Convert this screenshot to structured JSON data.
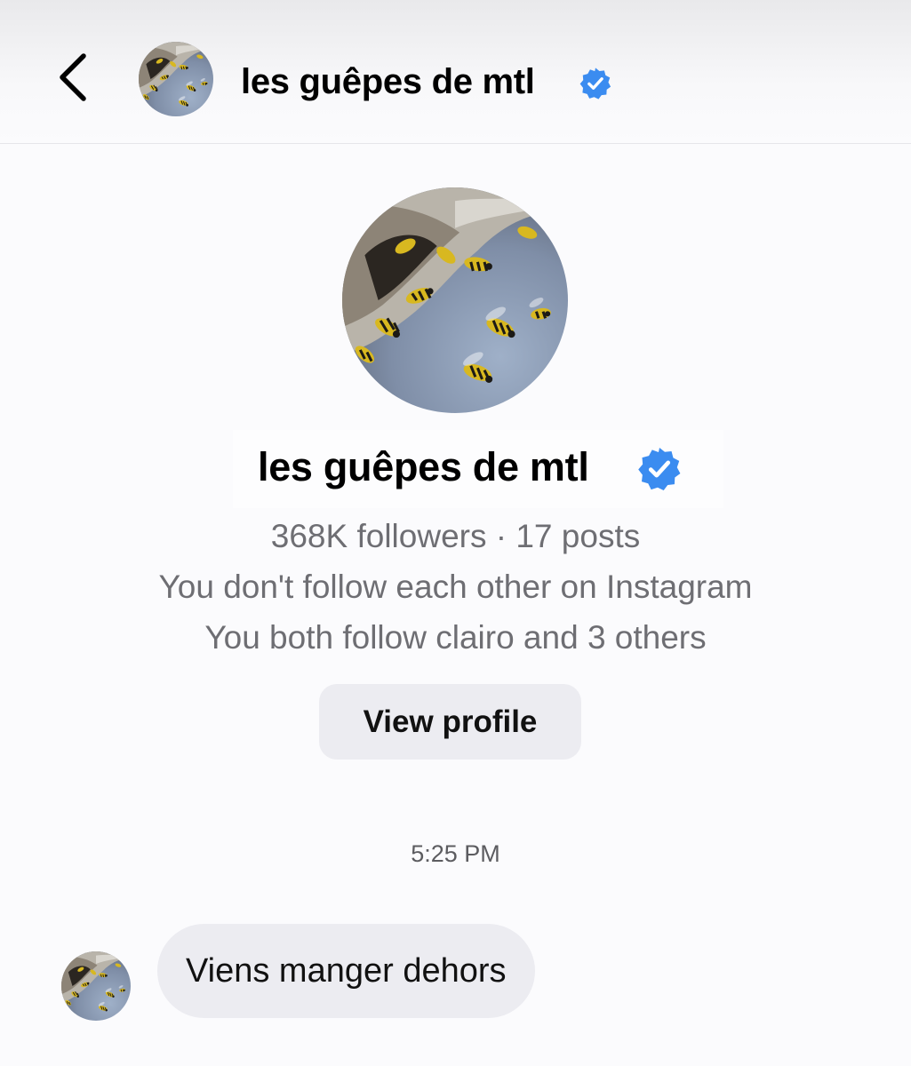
{
  "header": {
    "back_icon": "chevron-left-icon",
    "name": "les guêpes de mtl",
    "verified_icon": "verified-badge-icon",
    "avatar_icon": "wasps-avatar"
  },
  "profile": {
    "name": "les guêpes de mtl",
    "verified_icon": "verified-badge-icon",
    "followers_line": "368K followers · 17 posts",
    "follow_status_line": "You don't follow each other on Instagram",
    "mutual_line": "You both follow clairo and 3 others",
    "view_profile_label": "View profile"
  },
  "conversation": {
    "timestamp": "5:25 PM",
    "messages": [
      {
        "text": "Viens manger dehors",
        "incoming": true
      }
    ]
  },
  "colors": {
    "verified_blue": "#3b8cf0",
    "secondary_text": "#6e6e73",
    "button_bg": "#ececf1",
    "bubble_bg": "#ececf1"
  }
}
